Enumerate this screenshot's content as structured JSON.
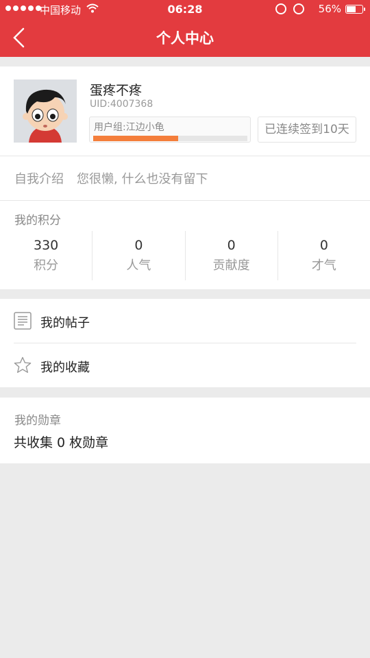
{
  "status_bar": {
    "carrier": "中国移动",
    "time": "06:28",
    "battery": "56%"
  },
  "nav": {
    "title": "个人中心"
  },
  "profile": {
    "username": "蛋疼不疼",
    "uid": "UID:4007368",
    "group": "用户组:江边小龟",
    "group_progress": 0.55,
    "checkin": "已连续签到10天"
  },
  "bio": {
    "label": "自我介绍",
    "text": "您很懒, 什么也没有留下"
  },
  "points": {
    "title": "我的积分",
    "stats": [
      {
        "value": "330",
        "label": "积分"
      },
      {
        "value": "0",
        "label": "人气"
      },
      {
        "value": "0",
        "label": "贡献度"
      },
      {
        "value": "0",
        "label": "才气"
      }
    ]
  },
  "menu": {
    "posts": "我的帖子",
    "favorites": "我的收藏"
  },
  "medals": {
    "title": "我的勋章",
    "summary": "共收集 0 枚勋章"
  },
  "colors": {
    "brand": "#e33b3f",
    "progress": "#f47e3b"
  }
}
